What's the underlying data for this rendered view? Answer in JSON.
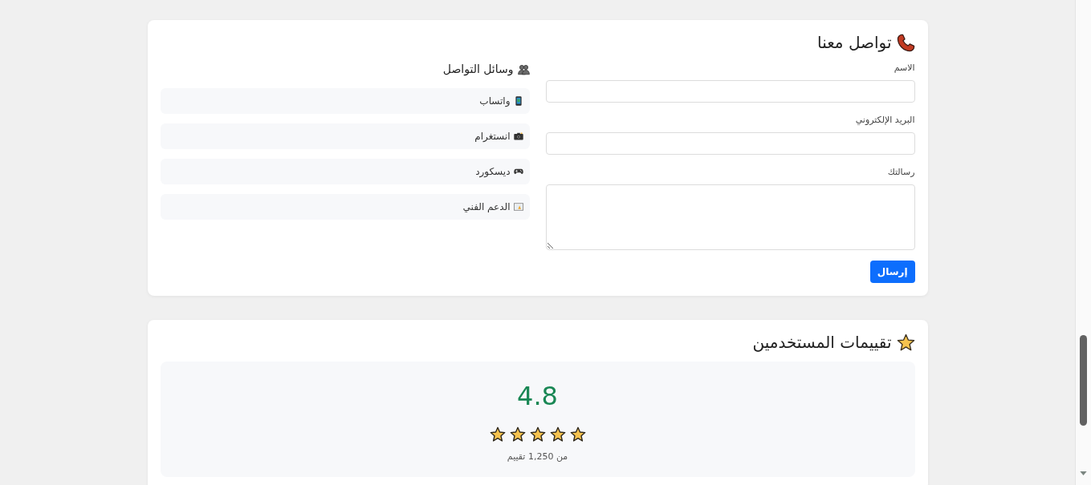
{
  "contact": {
    "title": "تواصل معنا",
    "form": {
      "fields": [
        {
          "label": "الاسم",
          "kind": "input"
        },
        {
          "label": "البريد الإلكتروني",
          "kind": "input"
        },
        {
          "label": "رسالتك",
          "kind": "textarea"
        }
      ],
      "submit": "إرسال"
    },
    "social": {
      "title": "وسائل التواصل",
      "items": [
        {
          "label": "واتساب"
        },
        {
          "label": "انستغرام"
        },
        {
          "label": "ديسكورد"
        },
        {
          "label": "الدعم الفني"
        }
      ]
    }
  },
  "ratings": {
    "title": "تقييمات المستخدمين",
    "average": "4.8",
    "stars": 5,
    "count_text": "من 1,250 تقييم"
  }
}
